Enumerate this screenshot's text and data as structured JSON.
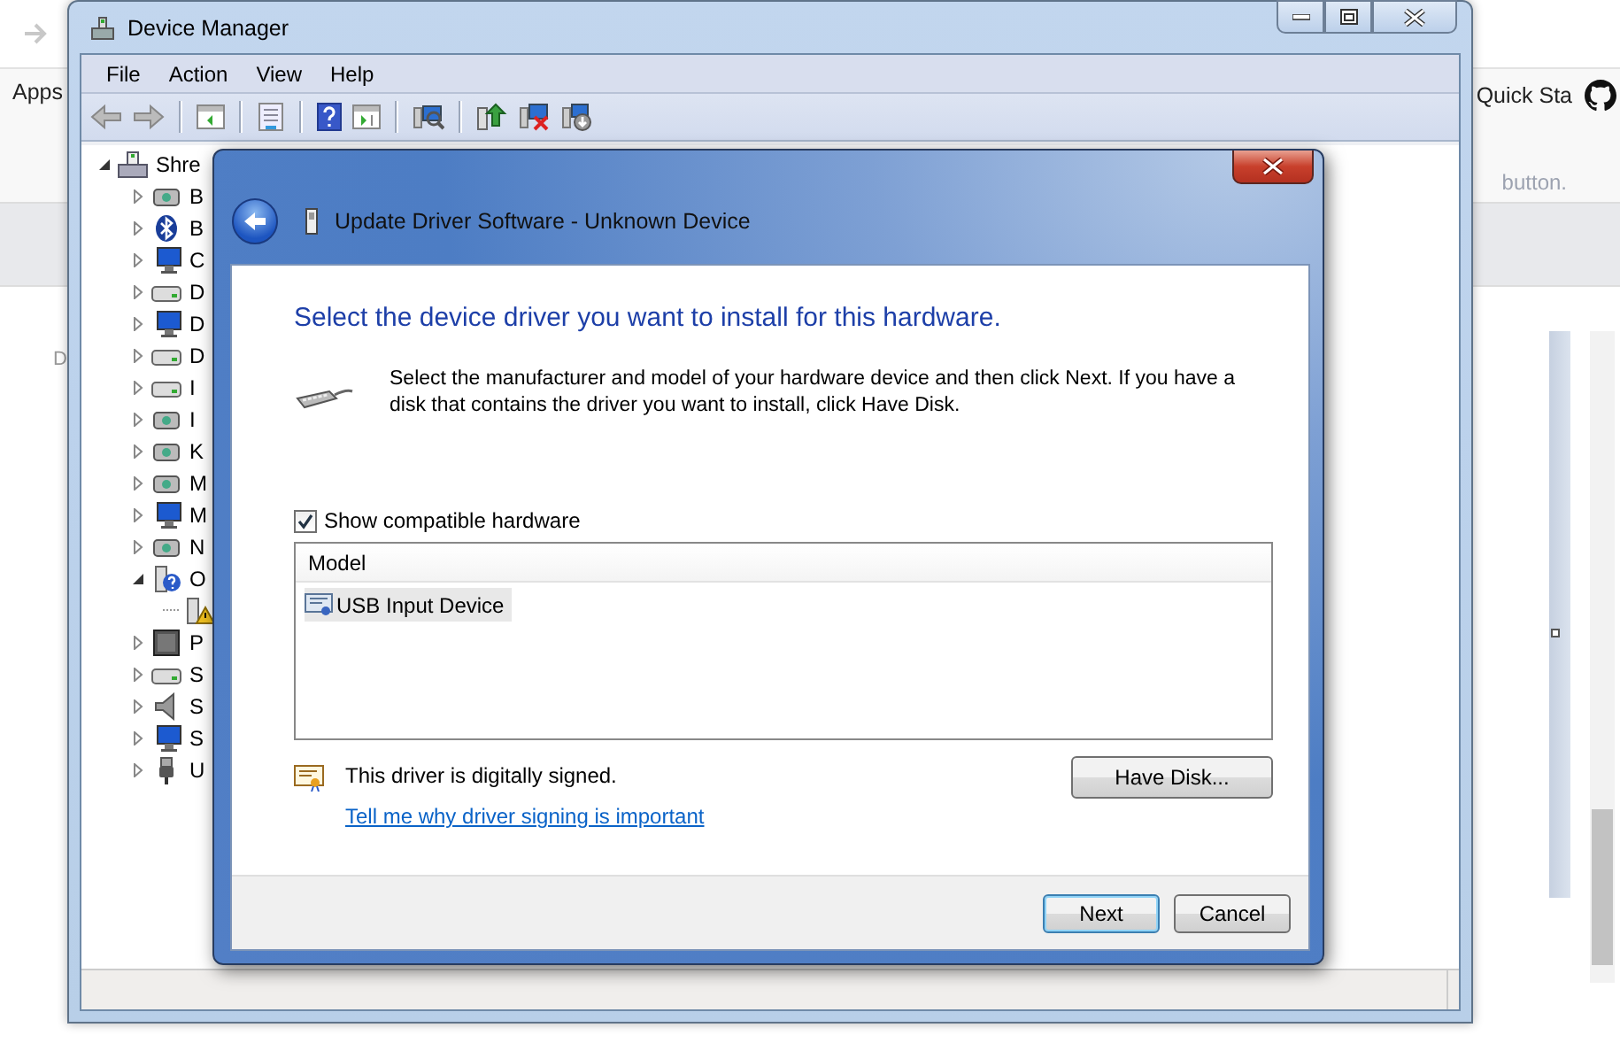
{
  "browser": {
    "bookmarks_label": "Apps",
    "bookmark": "Quick Sta",
    "page_text": "button.",
    "side_letter": "D"
  },
  "device_manager": {
    "title": "Device Manager",
    "menu": [
      "File",
      "Action",
      "View",
      "Help"
    ],
    "tree": [
      {
        "label": "Shre",
        "expanded": true,
        "children": [
          {
            "label": "B",
            "expanded": false
          },
          {
            "label": "B",
            "expanded": false
          },
          {
            "label": "C",
            "expanded": false
          },
          {
            "label": "D",
            "expanded": false
          },
          {
            "label": "D",
            "expanded": false
          },
          {
            "label": "D",
            "expanded": false
          },
          {
            "label": "I",
            "expanded": false
          },
          {
            "label": "I",
            "expanded": false
          },
          {
            "label": "K",
            "expanded": false
          },
          {
            "label": "M",
            "expanded": false
          },
          {
            "label": "M",
            "expanded": false
          },
          {
            "label": "N",
            "expanded": false
          },
          {
            "label": "O",
            "expanded": true,
            "children": [
              {
                "warning": true
              }
            ]
          },
          {
            "label": "P",
            "expanded": false
          },
          {
            "label": "S",
            "expanded": false
          },
          {
            "label": "S",
            "expanded": false
          },
          {
            "label": "S",
            "expanded": false
          },
          {
            "label": "U",
            "expanded": false
          }
        ]
      }
    ]
  },
  "dialog": {
    "title": "Update Driver Software - Unknown Device",
    "heading": "Select the device driver you want to install for this hardware.",
    "description": "Select the manufacturer and model of your hardware device and then click Next. If you have a disk that contains the driver you want to install, click Have Disk.",
    "show_compatible": {
      "label": "Show compatible hardware",
      "checked": true
    },
    "model_list": {
      "column": "Model",
      "rows": [
        {
          "label": "USB Input Device",
          "selected": true
        }
      ]
    },
    "signature": "This driver is digitally signed.",
    "link": "Tell me why driver signing is important",
    "have_disk": "Have Disk...",
    "buttons": [
      {
        "label": "Next",
        "default": true
      },
      {
        "label": "Cancel",
        "default": false
      }
    ]
  }
}
